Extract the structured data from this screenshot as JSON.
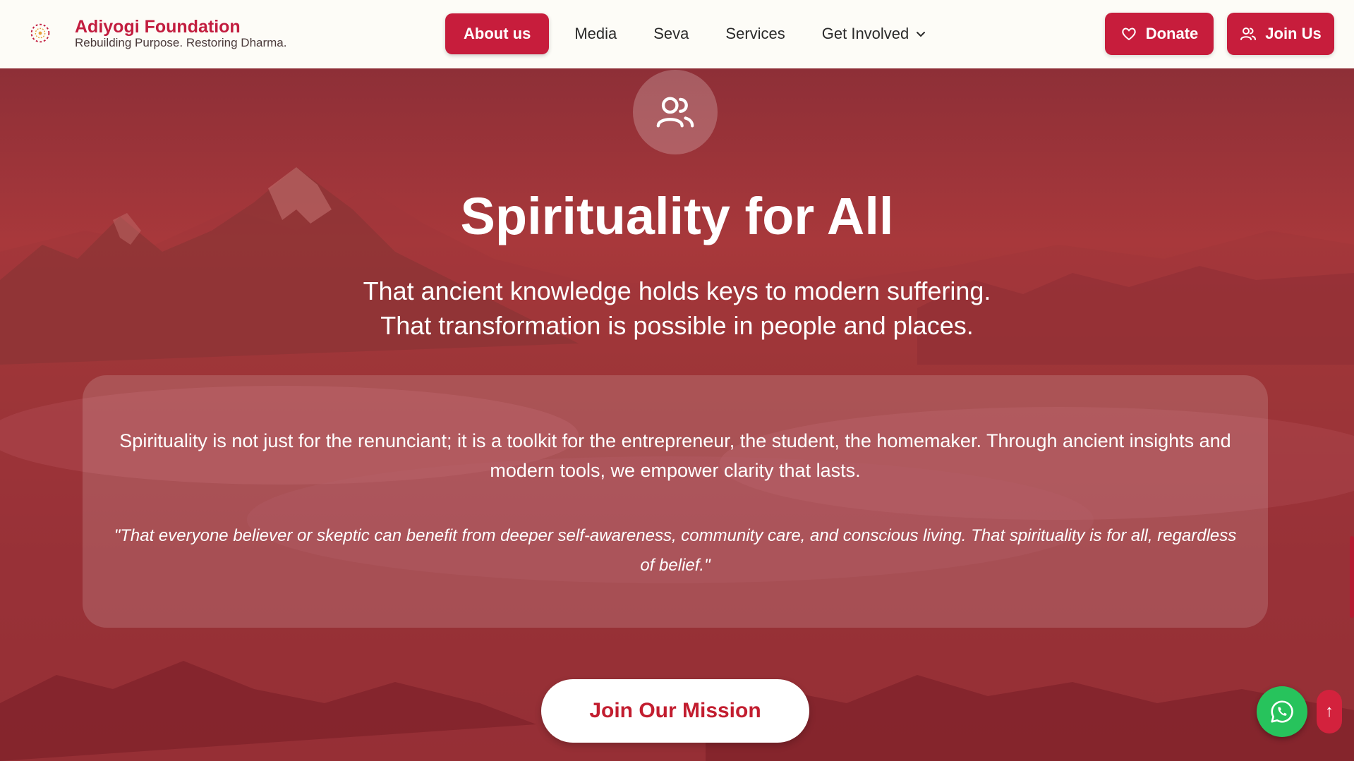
{
  "brand": {
    "name": "Adiyogi Foundation",
    "tagline": "Rebuilding Purpose. Restoring Dharma."
  },
  "nav": {
    "items": [
      {
        "label": "About us",
        "active": true
      },
      {
        "label": "Media"
      },
      {
        "label": "Seva"
      },
      {
        "label": "Services"
      },
      {
        "label": "Get Involved",
        "has_dropdown": true
      }
    ]
  },
  "header_buttons": {
    "donate": "Donate",
    "join": "Join Us"
  },
  "hero": {
    "icon": "users-icon",
    "title": "Spirituality for All",
    "subtitle_line1": "That ancient knowledge holds keys to modern suffering.",
    "subtitle_line2": "That transformation is possible in people and places."
  },
  "card": {
    "text": "Spirituality is not just for the renunciant; it is a toolkit for the entrepreneur, the student, the homemaker. Through ancient insights and modern tools, we empower clarity that lasts.",
    "quote": "\"That everyone believer or skeptic can benefit from deeper self-awareness, community care, and conscious living. That spirituality is for all, regardless of belief.\""
  },
  "cta": {
    "label": "Join Our Mission"
  },
  "floating": {
    "whatsapp_icon": "whatsapp-icon",
    "scroll_top_symbol": "↑"
  },
  "colors": {
    "brand": "#c21d3f",
    "button": "#c71d3c",
    "hero_overlay": "#8e2f37",
    "whatsapp": "#27c35c"
  }
}
